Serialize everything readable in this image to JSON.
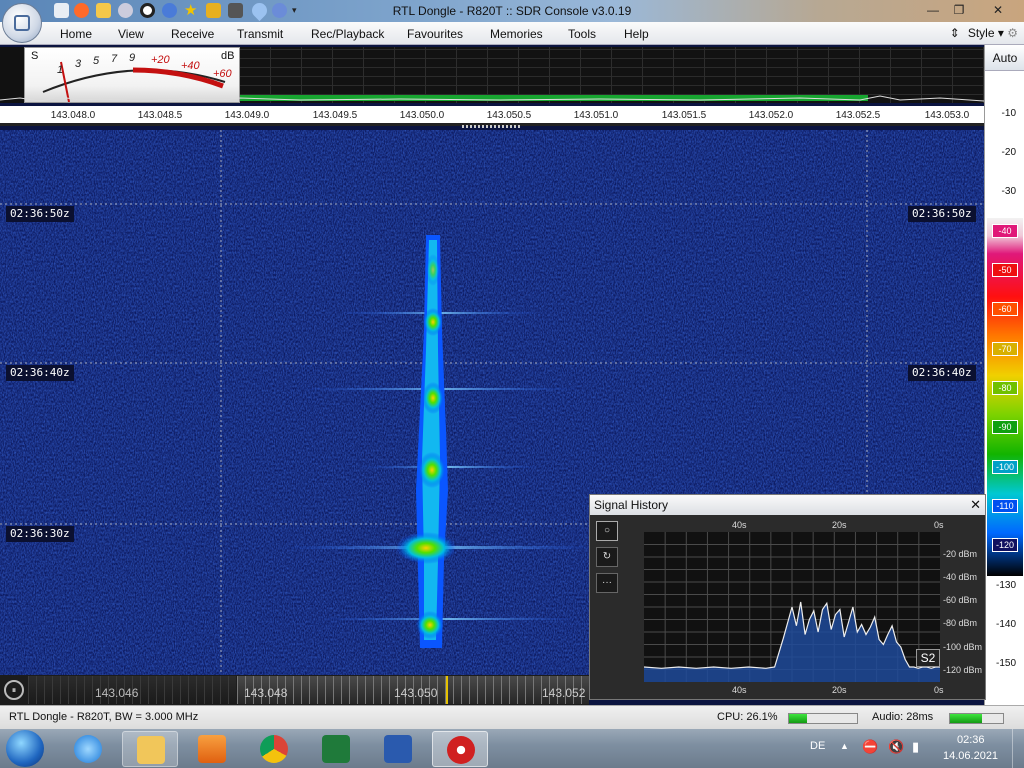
{
  "window": {
    "title": "RTL Dongle - R820T :: SDR Console v3.0.19",
    "controls": [
      "—",
      "❐",
      "✕"
    ]
  },
  "menu": {
    "items": [
      "Home",
      "View",
      "Receive",
      "Transmit",
      "Rec/Playback",
      "Favourites",
      "Memories",
      "Tools",
      "Help"
    ],
    "style_label": "Style"
  },
  "s_meter": {
    "s_label": "S",
    "db_label": "dB",
    "s_ticks": [
      "1",
      "3",
      "5",
      "7",
      "9"
    ],
    "plus_ticks": [
      "+20",
      "+40",
      "+60"
    ]
  },
  "spectrum": {
    "freq_ticks": [
      "143.048.0",
      "143.048.5",
      "143.049.0",
      "143.049.5",
      "143.050.0",
      "143.050.5",
      "143.051.0",
      "143.051.5",
      "143.052.0",
      "143.052.5",
      "143.053.0"
    ]
  },
  "scale": {
    "auto_label": "Auto",
    "levels": [
      "-10",
      "-20",
      "-30",
      "-40",
      "-50",
      "-60",
      "-70",
      "-80",
      "-90",
      "-100",
      "-110",
      "-120",
      "-130",
      "-140",
      "-150"
    ],
    "boxed_levels": [
      "-40",
      "-50",
      "-60",
      "-70",
      "-80",
      "-90",
      "-100",
      "-110",
      "-120"
    ]
  },
  "waterfall": {
    "time_labels": [
      "02:36:50z",
      "02:36:40z",
      "02:36:30z"
    ]
  },
  "signal_history": {
    "title": "Signal History",
    "close": "✕",
    "time_labels": [
      "40s",
      "20s",
      "0s"
    ],
    "db_labels": [
      "-20 dBm",
      "-40 dBm",
      "-60 dBm",
      "-80 dBm",
      "-100 dBm",
      "-120 dBm"
    ],
    "s_reading": "S2",
    "buttons": [
      "○",
      "↻",
      "···"
    ],
    "chart_data": {
      "type": "area",
      "x": [
        0,
        4,
        8,
        12,
        16,
        20,
        24,
        28,
        30,
        32,
        34,
        35,
        36,
        37,
        38,
        39,
        40,
        41,
        42,
        43,
        44,
        45,
        46,
        47,
        48,
        49,
        50,
        51,
        52,
        53,
        54,
        55,
        56,
        57,
        58,
        59,
        60,
        61,
        62,
        63,
        64,
        65,
        66,
        67,
        68
      ],
      "values": [
        -118,
        -119,
        -118,
        -119,
        -118,
        -119,
        -118,
        -119,
        -118,
        -95,
        -70,
        -85,
        -66,
        -92,
        -80,
        -73,
        -90,
        -72,
        -67,
        -88,
        -76,
        -72,
        -94,
        -82,
        -70,
        -90,
        -84,
        -92,
        -86,
        -78,
        -96,
        -100,
        -92,
        -85,
        -98,
        -102,
        -112,
        -118,
        -118,
        -119,
        -118,
        -118,
        -119,
        -118,
        -118
      ],
      "xlim": [
        0,
        68
      ],
      "ylim": [
        -130,
        -10
      ]
    }
  },
  "tuner": {
    "freqs": [
      "143.046",
      "143.048",
      "143.050",
      "143.052"
    ]
  },
  "status": {
    "device": "RTL Dongle - R820T, BW = 3.000 MHz",
    "cpu": "CPU: 26.1%",
    "audio": "Audio: 28ms",
    "cpu_level": 0.26,
    "audio_level": 0.6
  },
  "taskbar": {
    "lang": "DE",
    "time": "02:36",
    "date": "14.06.2021"
  }
}
